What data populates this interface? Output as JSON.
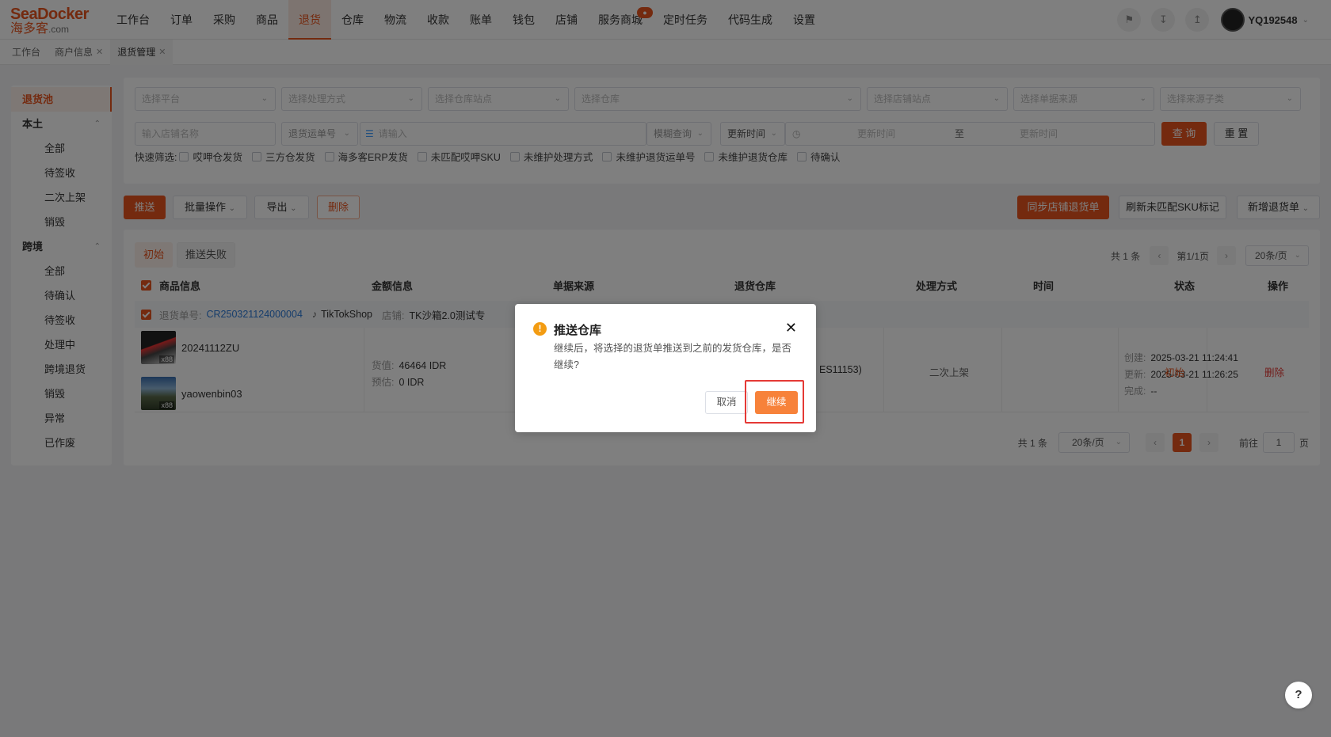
{
  "logo": {
    "brand_en": "SeaDocker",
    "brand_cn": "海多客",
    "suffix": ".com"
  },
  "nav": {
    "items": [
      "工作台",
      "订单",
      "采购",
      "商品",
      "退货",
      "仓库",
      "物流",
      "收款",
      "账单",
      "钱包",
      "店铺",
      "服务商城",
      "定时任务",
      "代码生成",
      "设置"
    ],
    "active_index": 4,
    "badge_item": "服务商城"
  },
  "user": {
    "name": "YQ192548"
  },
  "page_tabs": [
    {
      "label": "工作台",
      "closable": false
    },
    {
      "label": "商户信息",
      "closable": true
    },
    {
      "label": "退货管理",
      "closable": true
    }
  ],
  "sidebar": {
    "top": "退货池",
    "group1": {
      "label": "本土",
      "items": [
        "全部",
        "待签收",
        "二次上架",
        "销毁"
      ]
    },
    "group2": {
      "label": "跨境",
      "items": [
        "全部",
        "待确认",
        "待签收",
        "处理中",
        "跨境退货",
        "销毁",
        "异常",
        "已作废"
      ]
    }
  },
  "filters": {
    "row1": [
      "选择平台",
      "选择处理方式",
      "选择仓库站点",
      "选择仓库",
      "选择店铺站点",
      "选择单据来源",
      "选择来源子类"
    ],
    "shop_name_placeholder": "输入店铺名称",
    "order_type": "退货运单号",
    "order_placeholder": "请输入",
    "fuzzy": "模糊查询",
    "time_type": "更新时间",
    "start_placeholder": "更新时间",
    "to": "至",
    "end_placeholder": "更新时间",
    "search_btn": "查 询",
    "reset_btn": "重 置",
    "quick_label": "快速筛选:",
    "quick": [
      "哎呷仓发货",
      "三方仓发货",
      "海多客ERP发货",
      "未匹配哎呷SKU",
      "未维护处理方式",
      "未维护退货运单号",
      "未维护退货仓库",
      "待确认"
    ]
  },
  "actions": {
    "push": "推送",
    "batch": "批量操作",
    "export": "导出",
    "delete": "删除",
    "sync": "同步店铺退货单",
    "refresh": "刷新未匹配SKU标记",
    "add": "新增退货单"
  },
  "status_tabs": [
    "初始",
    "推送失败"
  ],
  "pager_top": {
    "total": "共 1 条",
    "page": "第1/1页",
    "size": "20条/页"
  },
  "table": {
    "headers": [
      "商品信息",
      "金额信息",
      "单据来源",
      "退货仓库",
      "处理方式",
      "时间",
      "状态",
      "操作"
    ],
    "order": {
      "no_label": "退货单号:",
      "no": "CR250321124000004",
      "platform": "TikTokShop",
      "shop_label": "店铺:",
      "shop": "TK沙箱2.0测试专"
    },
    "products": [
      {
        "sku": "20241112ZU",
        "qty": "x88"
      },
      {
        "sku": "yaowenbin03",
        "qty": "x88"
      }
    ],
    "amount": {
      "goods_label": "货值:",
      "goods": "46464 IDR",
      "est_label": "预估:",
      "est": "0 IDR"
    },
    "warehouse_tail": "ES11153)",
    "handling": "二次上架",
    "time": {
      "created_label": "创建:",
      "created": "2025-03-21 11:24:41",
      "updated_label": "更新:",
      "updated": "2025-03-21 11:26:25",
      "done_label": "完成:",
      "done": "--"
    },
    "status": "初始",
    "op": "删除"
  },
  "pager_bottom": {
    "total": "共 1 条",
    "size": "20条/页",
    "page": "1",
    "goto": "前往",
    "goto_val": "1",
    "unit": "页"
  },
  "dialog": {
    "title": "推送仓库",
    "message": "继续后，将选择的退货单推送到之前的发货仓库，是否继续?",
    "cancel": "取消",
    "confirm": "继续"
  },
  "help": "?",
  "colors": {
    "brand": "#e8541e",
    "confirm": "#f7823a",
    "highlight": "#e53935",
    "warn": "#f39c12"
  }
}
